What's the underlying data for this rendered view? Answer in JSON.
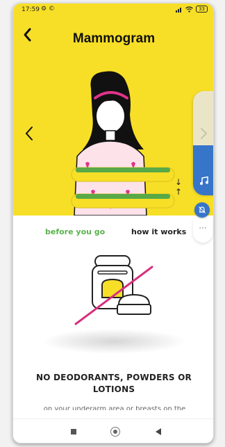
{
  "status_bar": {
    "time": "17:59",
    "left_icons": "⚙ ©",
    "signal": "▐▌",
    "wifi": "◠",
    "battery": "33"
  },
  "header": {
    "title": "Mammogram",
    "back_icon": "chevron-left-icon"
  },
  "tabs": {
    "before": "before you go",
    "how": "how it works",
    "active": "before"
  },
  "side_menu": {
    "more": "···",
    "icons": [
      "chevron-right-icon",
      "music-note-icon",
      "bell-icon"
    ]
  },
  "hero": {
    "arrows": "↓\n↑",
    "background": "#f7df27"
  },
  "tip": {
    "title": "NO DEODORANTS, POWDERS OR LOTIONS",
    "body": "on your underarm area or breasts on the day of your mammogram"
  },
  "colors": {
    "accent_green": "#5bb24e",
    "accent_blue": "#3775c9",
    "accent_pink": "#d6307d",
    "hero_yellow": "#f7df27"
  }
}
